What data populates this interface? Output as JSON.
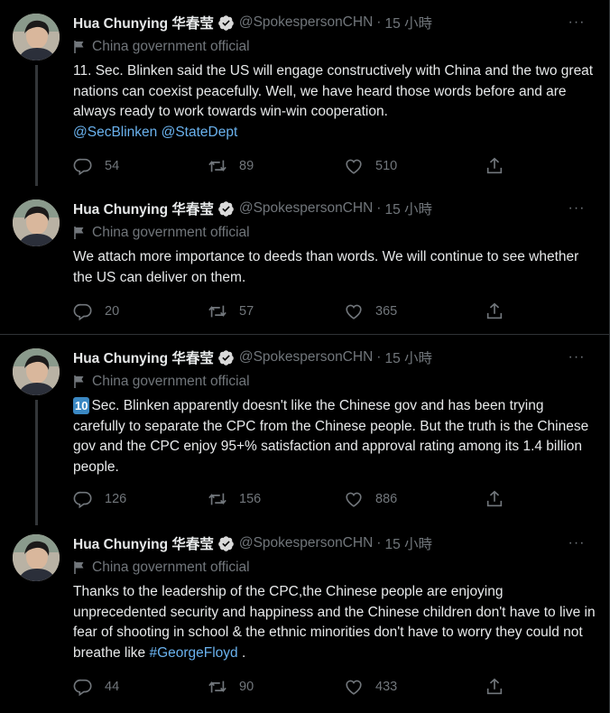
{
  "icons": {
    "verified": "verified-badge-icon",
    "label": "flag-icon",
    "reply": "reply-icon",
    "retweet": "retweet-icon",
    "like": "heart-icon",
    "share": "share-icon",
    "more": "more-icon"
  },
  "colors": {
    "background": "#000000",
    "text": "#e7e9ea",
    "muted": "#71767b",
    "link": "#6ab2ee",
    "divider": "#2f3336"
  },
  "tweets": [
    {
      "name": "Hua Chunying 华春莹",
      "handle": "@SpokespersonCHN",
      "dot": "·",
      "time": "15 小時",
      "more": "···",
      "label": "China government official",
      "text": "11. Sec. Blinken said the US will engage constructively with China and the two great nations can coexist peacefully. Well, we have heard those words before and are always ready to work towards win-win cooperation.",
      "links": [
        "@SecBlinken",
        "@StateDept"
      ],
      "replies": "54",
      "retweets": "89",
      "likes": "510"
    },
    {
      "name": "Hua Chunying 华春莹",
      "handle": "@SpokespersonCHN",
      "dot": "·",
      "time": "15 小時",
      "more": "···",
      "label": "China government official",
      "text": "We attach more importance to deeds than words. We will continue to see whether the US can deliver on them.",
      "replies": "20",
      "retweets": "57",
      "likes": "365"
    },
    {
      "name": "Hua Chunying 华春莹",
      "handle": "@SpokespersonCHN",
      "dot": "·",
      "time": "15 小時",
      "more": "···",
      "label": "China government official",
      "emoji": "10",
      "text": "Sec. Blinken apparently doesn't like the Chinese gov and has been trying carefully to separate the CPC from the Chinese people. But the truth is the Chinese gov and the CPC enjoy 95+% satisfaction and approval rating among its 1.4 billion people.",
      "replies": "126",
      "retweets": "156",
      "likes": "886"
    },
    {
      "name": "Hua Chunying 华春莹",
      "handle": "@SpokespersonCHN",
      "dot": "·",
      "time": "15 小時",
      "more": "···",
      "label": "China government official",
      "text": "Thanks to the leadership of the CPC,the Chinese people are enjoying unprecedented security and happiness and the Chinese children don't have to live in fear of shooting in school & the ethnic minorities don't have to worry they could not breathe like",
      "hashtag": "#GeorgeFloyd",
      "tail": ".",
      "replies": "44",
      "retweets": "90",
      "likes": "433"
    }
  ]
}
